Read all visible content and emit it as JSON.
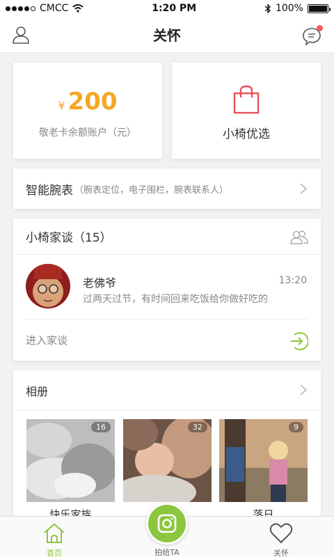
{
  "status_bar": {
    "carrier": "CMCC",
    "time": "1:20 PM",
    "battery": "100%",
    "signal_dots_filled": 4,
    "signal_dots_total": 5
  },
  "nav": {
    "title": "关怀",
    "left_icon": "user-icon",
    "right_icon": "message-icon",
    "has_notification": true
  },
  "balance": {
    "currency": "¥",
    "amount": "200",
    "label": "敬老卡余额账户（元）"
  },
  "shop": {
    "label": "小椅优选",
    "icon": "shopping-bag-icon"
  },
  "watch": {
    "title": "智能腕表",
    "description": "（腕表定位，电子围栏，腕表联系人）"
  },
  "family_chat": {
    "title": "小椅家谈（15）",
    "message": {
      "sender": "老佛爷",
      "time": "13:20",
      "text": "过两天过节，有时间回来吃饭给你做好吃的"
    },
    "enter_label": "进入家谈"
  },
  "album": {
    "title": "相册",
    "photos": [
      {
        "caption": "快乐家族",
        "count": "16"
      },
      {
        "caption": "",
        "count": "32"
      },
      {
        "caption": "落日",
        "count": "9"
      }
    ]
  },
  "tabbar": {
    "home": "首页",
    "camera": "拍给TA",
    "care": "关怀"
  },
  "colors": {
    "accent_green": "#8cc63f",
    "amount_orange": "#f5a623",
    "bag_red": "#e8505b",
    "badge_red": "#f25c5c"
  }
}
